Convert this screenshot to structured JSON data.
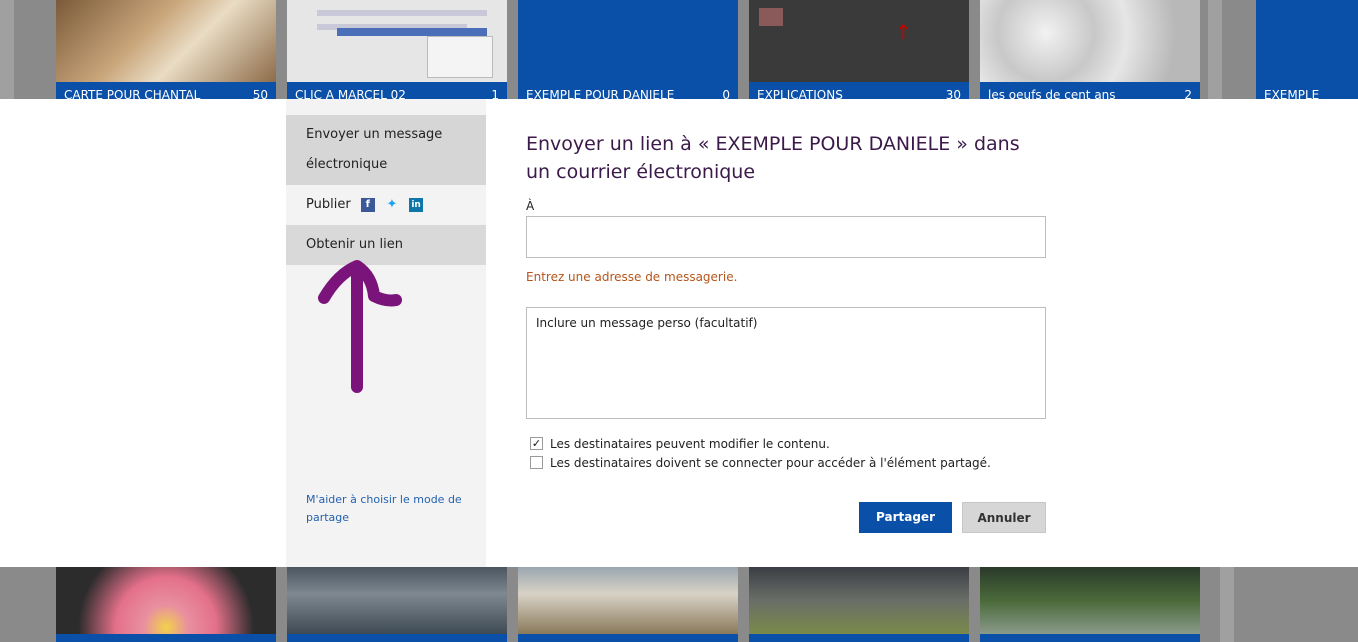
{
  "background_tiles_top": [
    {
      "title": "CARTE POUR CHANTAL",
      "count": "50"
    },
    {
      "title": "CLIC A MARCEL 02",
      "count": "1"
    },
    {
      "title": "EXEMPLE POUR DANIELE",
      "count": "0"
    },
    {
      "title": "EXPLICATIONS",
      "count": "30"
    },
    {
      "title": "les oeufs de cent ans",
      "count": "2"
    },
    {
      "title": "EXEMPLE POUR",
      "count": ""
    }
  ],
  "dialog": {
    "nav": {
      "email": "Envoyer un message électronique",
      "publish": "Publier",
      "get_link": "Obtenir un lien",
      "help": "M'aider à choisir le mode de partage"
    },
    "social_icons": [
      "facebook-icon",
      "twitter-icon",
      "linkedin-icon"
    ],
    "title": "Envoyer un lien à « EXEMPLE POUR DANIELE » dans un courrier électronique",
    "to_label": "À",
    "to_value": "",
    "error": "Entrez une adresse de messagerie.",
    "message_placeholder": "Inclure un message perso (facultatif)",
    "checkbox_edit": {
      "label": "Les destinataires peuvent modifier le contenu.",
      "checked": true
    },
    "checkbox_signin": {
      "label": "Les destinataires doivent se connecter pour accéder à l'élément partagé.",
      "checked": false
    },
    "share_button": "Partager",
    "cancel_button": "Annuler"
  },
  "colors": {
    "accent_blue": "#0a4fa8",
    "error_orange": "#b5551a",
    "annotation_purple": "#7a137a"
  }
}
